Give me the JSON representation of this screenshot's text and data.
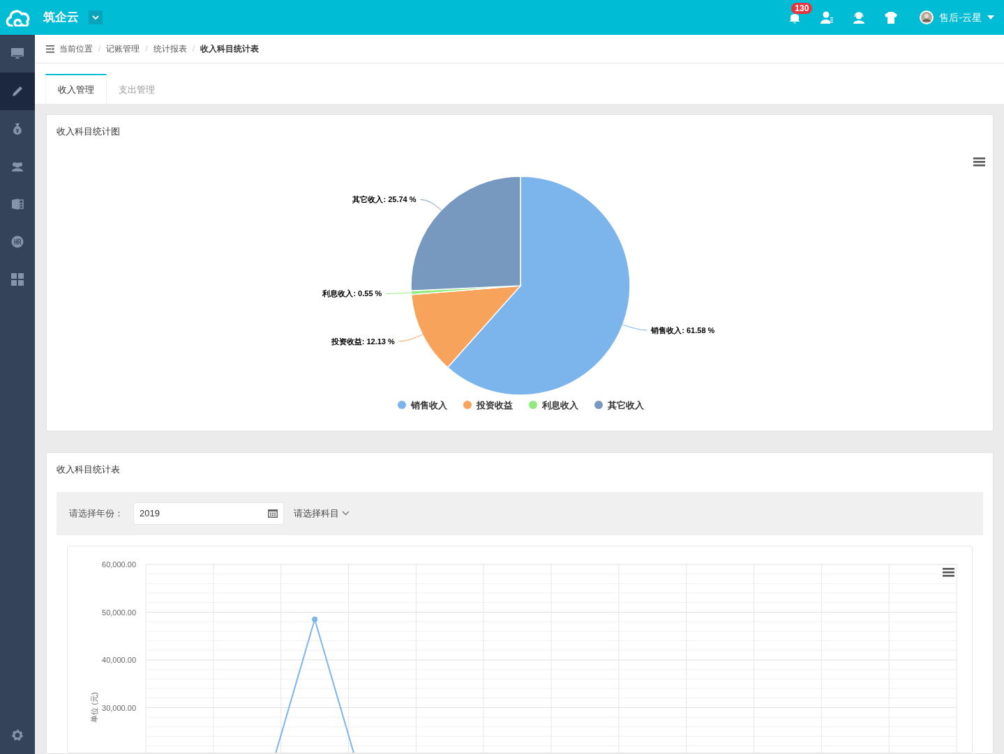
{
  "header": {
    "app_name": "筑企云",
    "notification_count": "130",
    "user_name": "售后-云星"
  },
  "sidebar": {
    "items": [
      {
        "selected": false
      },
      {
        "selected": true
      },
      {
        "selected": false
      },
      {
        "selected": false
      },
      {
        "selected": false
      },
      {
        "selected": false
      },
      {
        "selected": false
      }
    ]
  },
  "breadcrumb": [
    {
      "label": "当前位置"
    },
    {
      "separator": "/",
      "label": "记账管理"
    },
    {
      "separator": "/",
      "label": "统计报表"
    },
    {
      "separator": "/",
      "label": "收入科目统计表"
    }
  ],
  "tabs": [
    {
      "label": "收入管理",
      "selected": true
    },
    {
      "label": "支出管理",
      "selected": false
    }
  ],
  "pie_card": {
    "title": "收入科目统计图",
    "chart_data": {
      "type": "pie",
      "categories": [
        "销售收入",
        "投资收益",
        "利息收入",
        "其它收入"
      ],
      "values": [
        61.58,
        12.13,
        0.55,
        25.74
      ],
      "colors": [
        "#7cb5ec",
        "#f7a35c",
        "#90ed7d",
        "#7798bf"
      ],
      "legend": true,
      "data_labels": true,
      "value_labels": [
        "销售收入: 61.58 %",
        "投资收益: 12.13 %",
        "利息收入: 0.55 %",
        "其它收入: 25.74 %"
      ]
    }
  },
  "table_card": {
    "title": "收入科目统计表",
    "year_label": "请选择年份：",
    "year_value": "2019",
    "subject_placeholder": "请选择科目",
    "chart_data": {
      "type": "line",
      "ylabel": "单位 (元)",
      "ylim": [
        0,
        60000
      ],
      "grid": true,
      "yticks": [
        {
          "value": 30000,
          "label": "30,000.00"
        },
        {
          "value": 40000,
          "label": "40,000.00"
        },
        {
          "value": 50000,
          "label": "50,000.00"
        },
        {
          "value": 60000,
          "label": "60,000.00"
        }
      ],
      "series": [
        {
          "color": "#7cb5ec",
          "marker": true,
          "values": [
            null,
            0,
            48500,
            0,
            null,
            null,
            null,
            null,
            null,
            null,
            null,
            null
          ]
        }
      ]
    }
  }
}
